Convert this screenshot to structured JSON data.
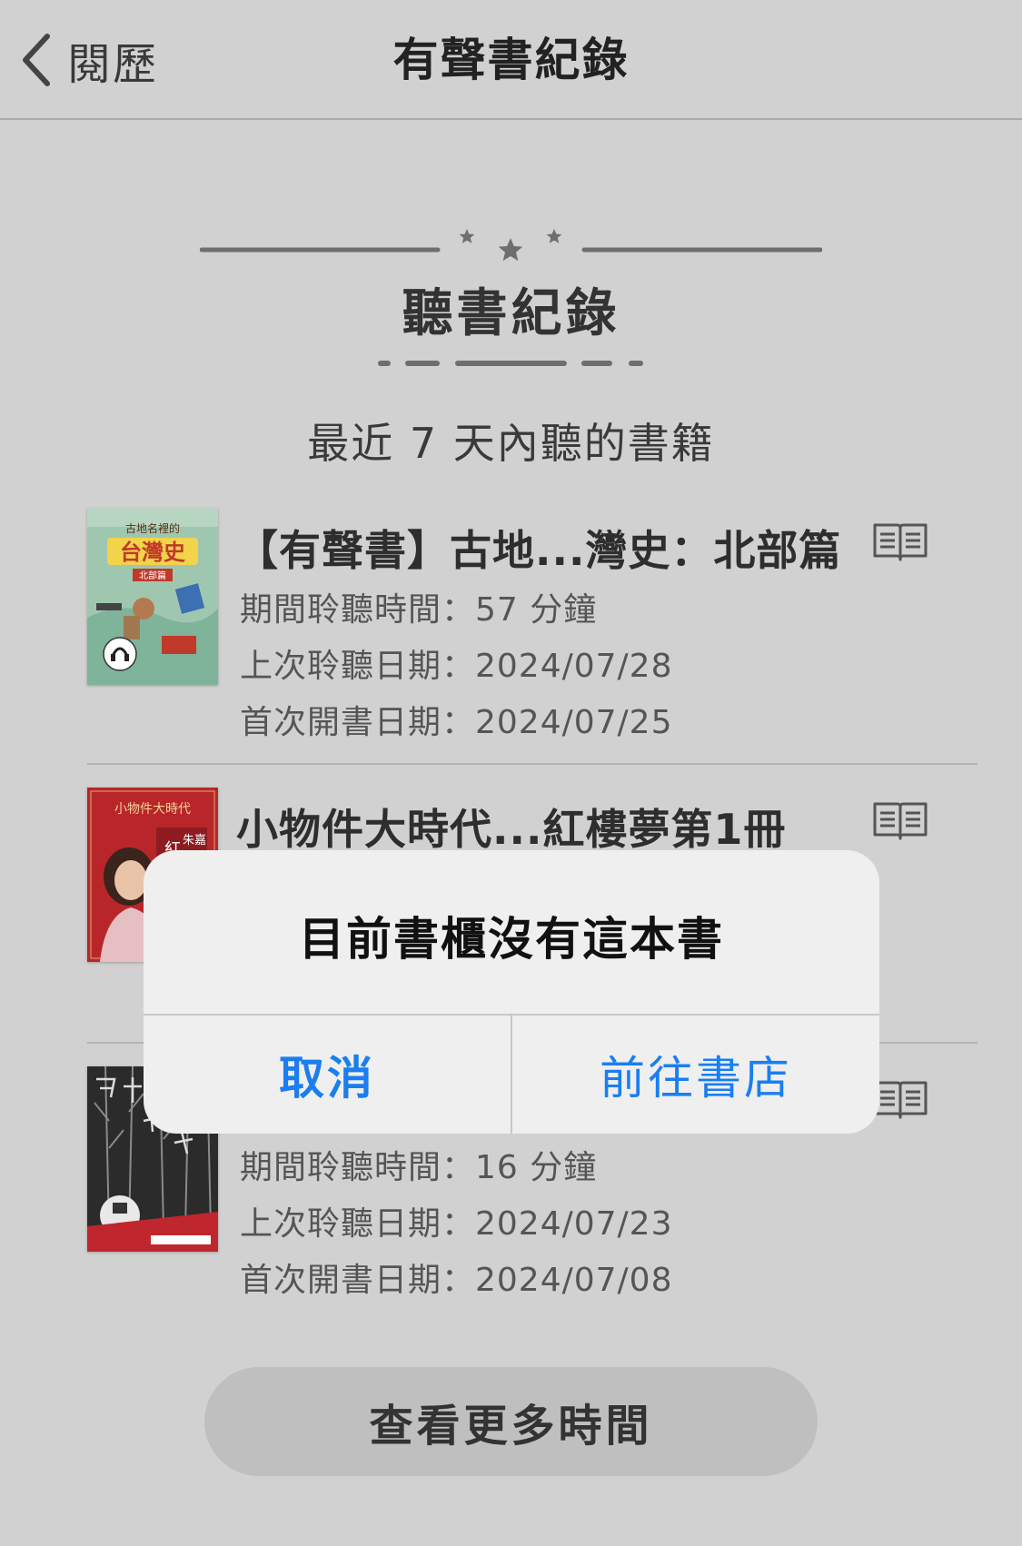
{
  "nav": {
    "back_label": "閱歷",
    "title": "有聲書紀錄"
  },
  "section": {
    "title": "聽書紀錄",
    "subtitle": "最近 7 天內聽的書籍"
  },
  "books": [
    {
      "title": "【有聲書】古地...灣史：北部篇",
      "listen_time": "期間聆聽時間：57 分鐘",
      "last_listen": "上次聆聽日期：2024/07/28",
      "first_open": "首次開書日期：2024/07/25",
      "cover": {
        "title": "台灣史",
        "series": "古地名裡的",
        "part": "北部篇",
        "colors": {
          "bg": "#9fc7b0",
          "accent": "#c0392b",
          "label": "#f3d34a"
        }
      }
    },
    {
      "title": "小物件大時代...紅樓夢第1冊",
      "cover": {
        "series": "小物件大時代",
        "title": "紅",
        "author": "朱嘉",
        "colors": {
          "bg": "#b8262a",
          "accent": "#f1d29a"
        }
      }
    },
    {
      "listen_time": "期間聆聽時間：16 分鐘",
      "last_listen": "上次聆聽日期：2024/07/23",
      "first_open": "首次開書日期：2024/07/08",
      "cover": {
        "colors": {
          "bg": "#2b2b2b",
          "accent": "#c0262d"
        }
      }
    }
  ],
  "more_button": "查看更多時間",
  "alert": {
    "message": "目前書櫃沒有這本書",
    "cancel": "取消",
    "go_store": "前往書店"
  },
  "colors": {
    "background": "#d1d1d1",
    "link_blue": "#1a7ef0",
    "alert_bg": "#efefef"
  }
}
